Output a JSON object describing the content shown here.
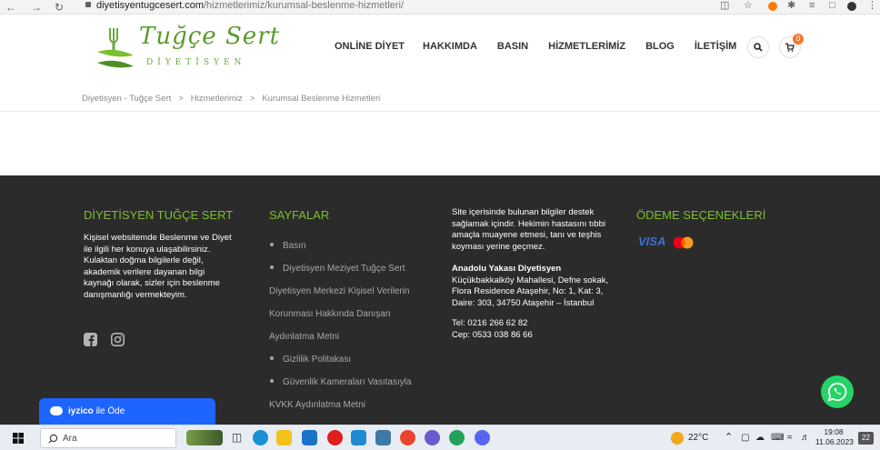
{
  "browser": {
    "url_host": "diyetisyentugcesert.com",
    "url_path": "/hizmetlerimiz/kurumsal-beslenme-hizmetleri/"
  },
  "header": {
    "logo_script": "Tuğçe Sert",
    "logo_subtitle": "DİYETİSYEN",
    "nav": [
      "ONLİNE DİYET",
      "HAKKIMDA",
      "BASIN",
      "HİZMETLERİMİZ",
      "BLOG",
      "İLETİŞİM"
    ],
    "cart_count": "0"
  },
  "breadcrumb": {
    "sep": ">",
    "items": [
      "Diyetisyen - Tuğçe Sert",
      "Hizmetlerimiz",
      "Kurumsal Beslenme Hizmetleri"
    ]
  },
  "footer": {
    "col1": {
      "heading": "DİYETİSYEN TUĞÇE SERT",
      "lines": [
        "Kişisel websitemde Beslenme ve Diyet",
        "ile ilgili her konuya ulaşabilirsiniz.",
        "Kulaktan doğma bilgilerle değil,",
        "akademik verilere dayanan bilgi",
        "kaynağı olarak, sizler için beslenme",
        "danışmanlığı vermekteyim."
      ]
    },
    "col2": {
      "heading": "SAYFALAR",
      "links": [
        "Basın",
        "Diyetisyen Meziyet Tuğçe Sert",
        "Diyetisyen Merkezi Kişisel Verilerin",
        "Korunması Hakkında Danışan",
        "Aydınlatma Metni",
        "Gizlilik Politakası",
        "Güvenlik Kameraları Vasıtasıyla",
        "KVKK Aydınlatma Metni"
      ]
    },
    "col3": {
      "disclaimer": [
        "Site içerisinde bulunan bilgiler destek",
        "sağlamak içindir. Hekimin hastasını tıbbi",
        "amaçla muayene etmesi, tanı ve teşhis",
        "koyması yerine geçmez."
      ],
      "address_title": "Anadolu Yakası Diyetisyen",
      "address": [
        "Küçükbakkalköy Mahallesi, Defne sokak,",
        "Flora Residence Ataşehir, No: 1, Kat: 3,",
        "Daire: 303, 34750 Ataşehir – İstanbul"
      ],
      "tel": "Tel: 0216 266 62 82",
      "cep": "Cep: 0533 038 86 66"
    },
    "col4": {
      "heading": "ÖDEME SEÇENEKLERİ",
      "visa": "VISA"
    }
  },
  "iyzico": {
    "brand": "iyzico",
    "label": "ile Öde"
  },
  "taskbar": {
    "search_placeholder": "Ara",
    "temperature": "22°C",
    "time": "19:08",
    "date": "11.06.2023",
    "notif_count": "22"
  },
  "colors": {
    "brand_green": "#7bbf2e",
    "footer_bg": "#2b2b2b",
    "whatsapp": "#25d366",
    "iyzico_blue": "#1e64ff",
    "cart_badge": "#f07a2e"
  }
}
